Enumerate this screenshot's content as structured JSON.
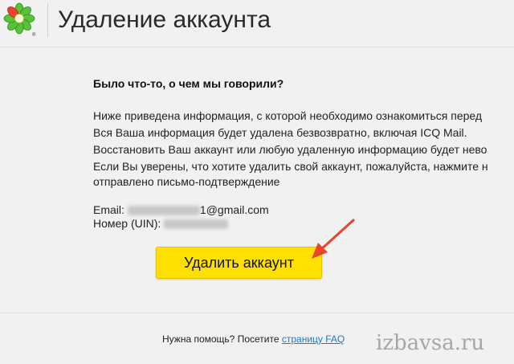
{
  "header": {
    "title": "Удаление аккаунта",
    "logo_icon": "icq-flower-logo-icon"
  },
  "content": {
    "question": "Было что-то, о чем мы говорили?",
    "paragraphs": [
      "Ниже приведена информация, с которой необходимо ознакомиться перед",
      "Вся Ваша информация будет удалена безвозвратно, включая ICQ Mail.",
      "Восстановить Ваш аккаунт или любую удаленную информацию будет нево",
      "Если Вы уверены, что хотите удалить свой аккаунт, пожалуйста, нажмите н",
      "отправлено письмо-подтверждение"
    ],
    "email_label": "Email:",
    "email_suffix": "1@gmail.com",
    "uin_label": "Номер (UIN):",
    "delete_button_label": "Удалить аккаунт"
  },
  "footer": {
    "help_text": "Нужна помощь? Посетите",
    "faq_link": "страницу FAQ"
  },
  "watermark": "izbavsa.ru",
  "colors": {
    "button_bg": "#ffe000",
    "link": "#1d76c9",
    "arrow": "#e8452c",
    "logo_petals": "#59c23a"
  }
}
